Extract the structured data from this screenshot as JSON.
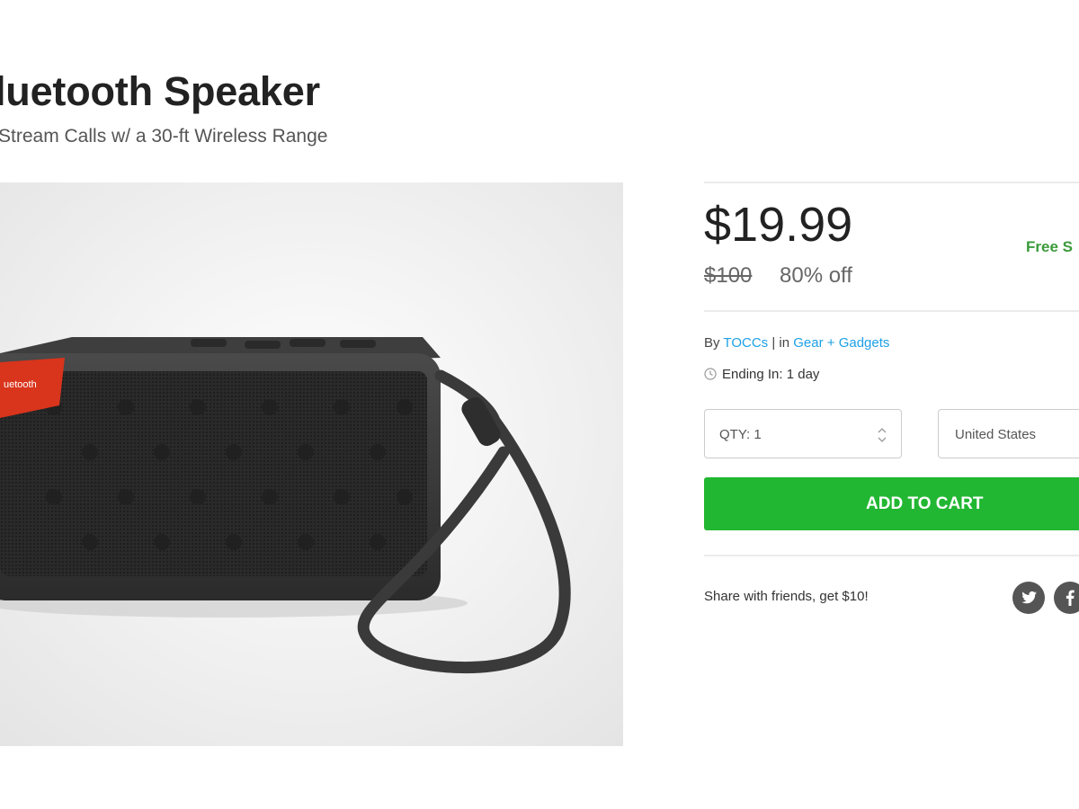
{
  "product": {
    "title": "luetooth Speaker",
    "subtitle": "Stream Calls w/ a 30-ft Wireless Range",
    "image_alt_text_on_device": "uetooth"
  },
  "pricing": {
    "price": "$19.99",
    "original_price": "$100",
    "discount": "80% off",
    "shipping_label": "Free S"
  },
  "details": {
    "by_label": "By",
    "vendor": "TOCCs",
    "separator": "|",
    "in_label": "in",
    "category": "Gear + Gadgets",
    "ending_label": "Ending In: 1 day"
  },
  "purchase": {
    "qty_label": "QTY: 1",
    "country": "United States",
    "add_to_cart_label": "ADD TO CART"
  },
  "share": {
    "text": "Share with friends, get $10!",
    "networks": [
      "twitter",
      "facebook"
    ]
  },
  "colors": {
    "accent_green": "#22b732",
    "shipping_green": "#3a9a3a",
    "link_blue": "#1ea0e6",
    "speaker_badge_red": "#d9341c",
    "social_icon_grey": "#555555"
  }
}
